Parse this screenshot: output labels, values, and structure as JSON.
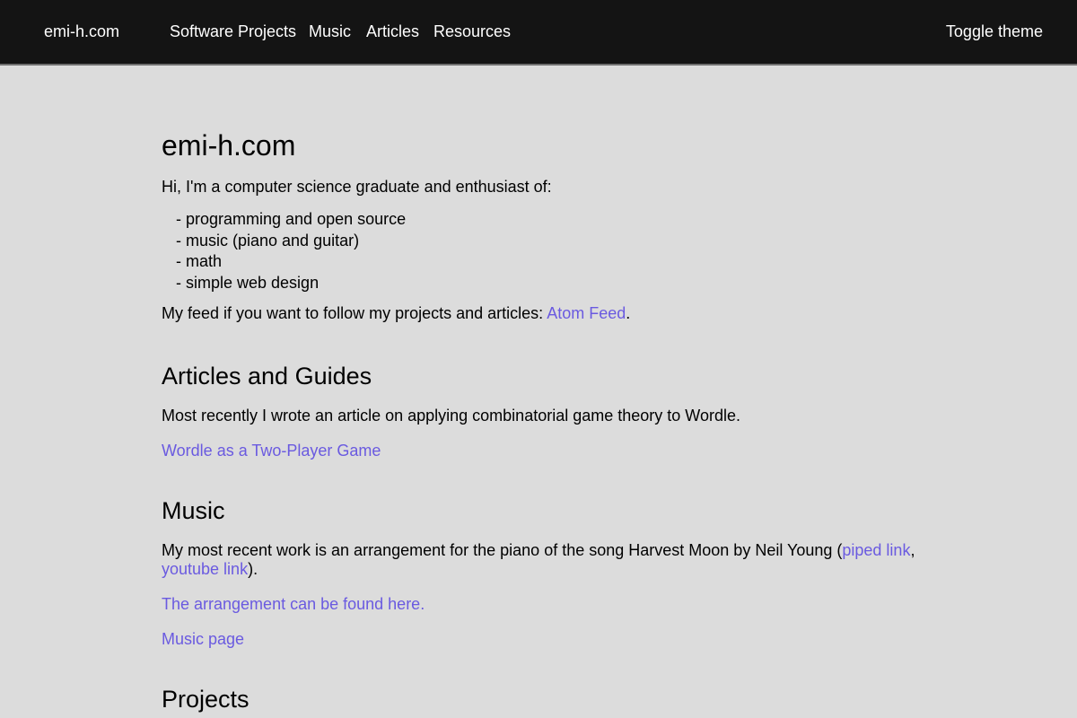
{
  "nav": {
    "brand": "emi-h.com",
    "links": [
      "Software Projects",
      "Music",
      "Articles",
      "Resources"
    ],
    "toggle": "Toggle theme"
  },
  "main": {
    "title": "emi-h.com",
    "intro": "Hi, I'm a computer science graduate and enthusiast of:",
    "interests": [
      "- programming and open source",
      "- music (piano and guitar)",
      "- math",
      "- simple web design"
    ],
    "feed_text": "My feed if you want to follow my projects and articles: ",
    "feed_link": "Atom Feed",
    "feed_end": ".",
    "articles": {
      "heading": "Articles and Guides",
      "text": "Most recently I wrote an article on applying combinatorial game theory to Wordle.",
      "link": "Wordle as a Two-Player Game"
    },
    "music": {
      "heading": "Music",
      "text_before": "My most recent work is an arrangement for the piano of the song Harvest Moon by Neil Young (",
      "piped_link": "piped link",
      "comma": ", ",
      "youtube_link": "youtube link",
      "text_after": ").",
      "arrangement_link": "The arrangement can be found here.",
      "page_link": "Music page"
    },
    "projects": {
      "heading": "Projects"
    }
  },
  "colors": {
    "background": "#dcdcdc",
    "topbar": "#141414",
    "link": "#6a5ae0"
  }
}
